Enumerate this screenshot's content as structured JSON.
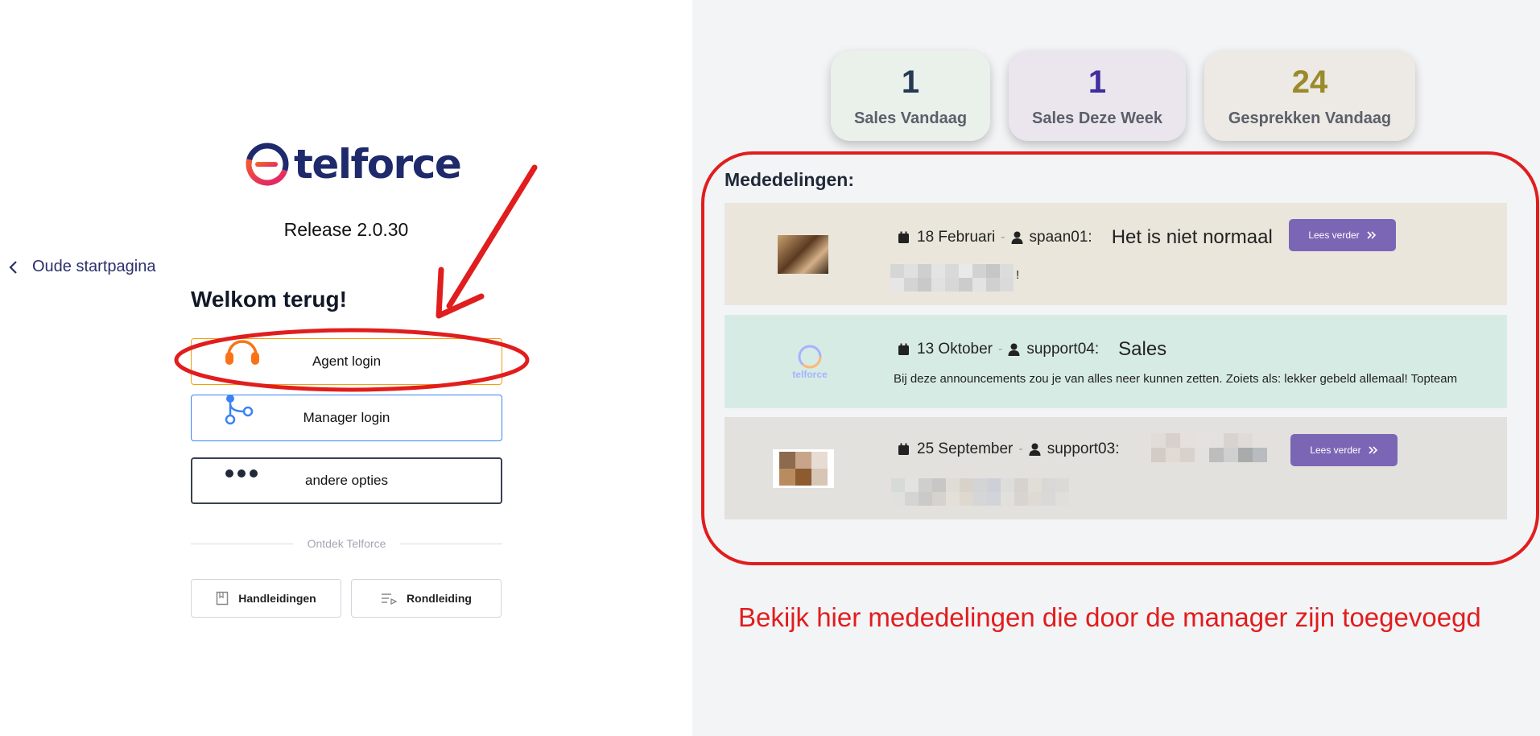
{
  "brand": {
    "name": "telforce",
    "release": "Release 2.0.30"
  },
  "nav": {
    "back_label": "Oude startpagina"
  },
  "login": {
    "welcome": "Welkom terug!",
    "agent_label": "Agent login",
    "manager_label": "Manager login",
    "other_label": "andere opties",
    "divider_label": "Ontdek Telforce",
    "manuals_label": "Handleidingen",
    "tour_label": "Rondleiding"
  },
  "stats": [
    {
      "value": "1",
      "label": "Sales Vandaag"
    },
    {
      "value": "1",
      "label": "Sales Deze Week"
    },
    {
      "value": "24",
      "label": "Gesprekken Vandaag"
    }
  ],
  "announcements": {
    "title": "Mededelingen:",
    "read_more": "Lees verder",
    "items": [
      {
        "date": "18 Februari",
        "author": "spaan01:",
        "subject": "Het is niet normaal",
        "body": "!"
      },
      {
        "date": "13 Oktober",
        "author": "support04:",
        "subject": "Sales",
        "body": "Bij deze announcements zou je van alles neer kunnen zetten. Zoiets als: lekker gebeld allemaal! Topteam"
      },
      {
        "date": "25 September",
        "author": "support03:",
        "subject": "",
        "body": ""
      }
    ]
  },
  "annotation": {
    "caption": "Bekijk hier mededelingen die door de manager zijn toegevoegd"
  },
  "colors": {
    "accent_red": "#e11d1d",
    "brand_navy": "#1e2a6b",
    "button_purple": "#7b66b5",
    "agent_orange": "#f97316",
    "manager_blue": "#3b82f6"
  }
}
